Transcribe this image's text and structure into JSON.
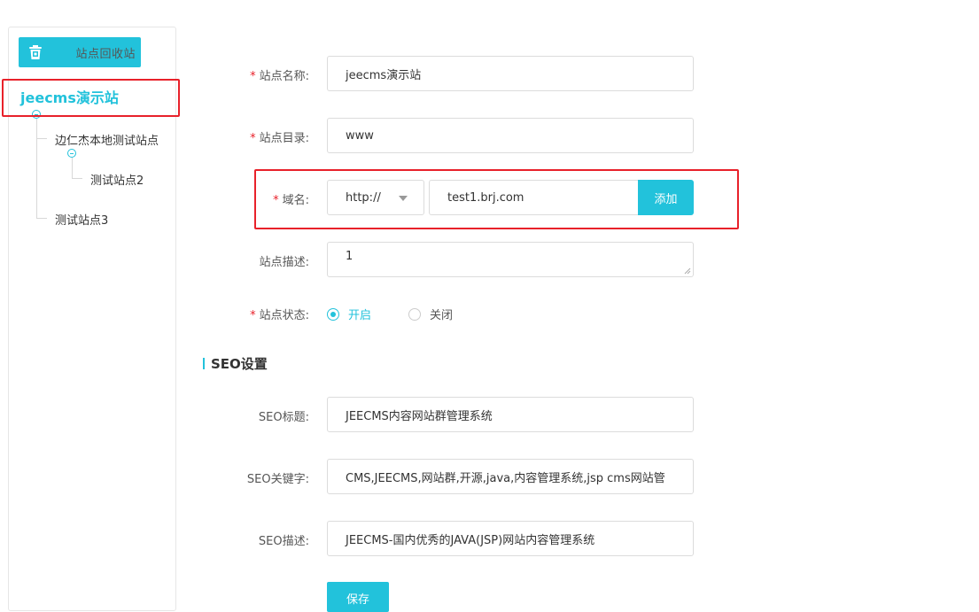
{
  "sidebar": {
    "recycle_button": "站点回收站",
    "tree": {
      "root": "jeecms演示站",
      "child1": "边仁杰本地测试站点",
      "grandchild1": "测试站点2",
      "child2": "测试站点3"
    }
  },
  "form": {
    "site_name": {
      "label": "站点名称:",
      "value": "jeecms演示站"
    },
    "site_dir": {
      "label": "站点目录:",
      "value": "www"
    },
    "domain": {
      "label": "域名:",
      "protocol": "http://",
      "value": "test1.brj.com",
      "add_label": "添加"
    },
    "site_desc": {
      "label": "站点描述:",
      "value": "1"
    },
    "site_status": {
      "label": "站点状态:",
      "on": "开启",
      "off": "关闭",
      "selected": "开启"
    }
  },
  "seo": {
    "section_title": "SEO设置",
    "title": {
      "label": "SEO标题:",
      "value": "JEECMS内容网站群管理系统"
    },
    "keywords": {
      "label": "SEO关键字:",
      "value": "CMS,JEECMS,网站群,开源,java,内容管理系统,jsp cms网站管"
    },
    "description": {
      "label": "SEO描述:",
      "value": "JEECMS-国内优秀的JAVA(JSP)网站内容管理系统"
    }
  },
  "save_label": "保存",
  "colors": {
    "accent": "#22c2db",
    "highlight": "#e8212a"
  }
}
